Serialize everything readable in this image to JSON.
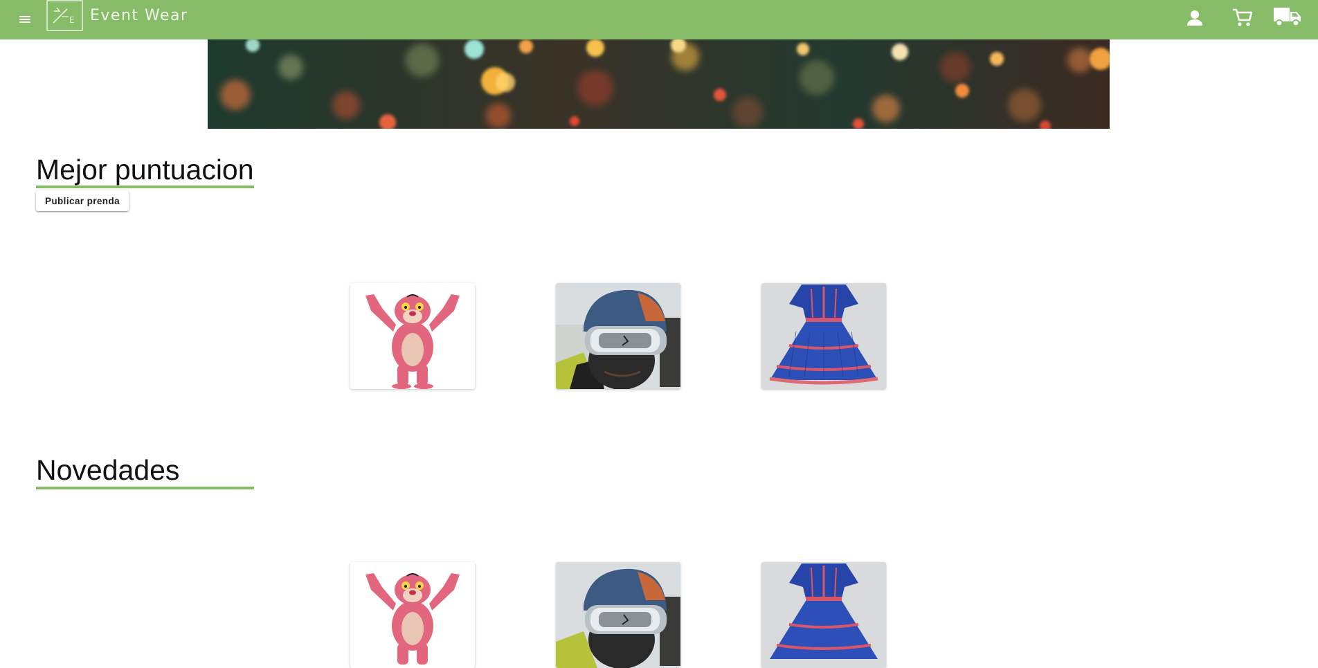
{
  "header": {
    "brand": "Event Wear",
    "logo_text": "E",
    "icons": [
      "menu-icon",
      "user-icon",
      "cart-icon",
      "truck-icon"
    ],
    "color": "#86bb67"
  },
  "sections": {
    "top_rated": {
      "title": "Mejor puntuacion",
      "publish_label": "Publicar prenda",
      "products": [
        "pink-panther-costume",
        "ski-helmet-goggles",
        "blue-ruffled-dress"
      ]
    },
    "new_arrivals": {
      "title": "Novedades",
      "products": [
        "pink-panther-costume",
        "ski-helmet-goggles",
        "blue-ruffled-dress"
      ]
    }
  }
}
